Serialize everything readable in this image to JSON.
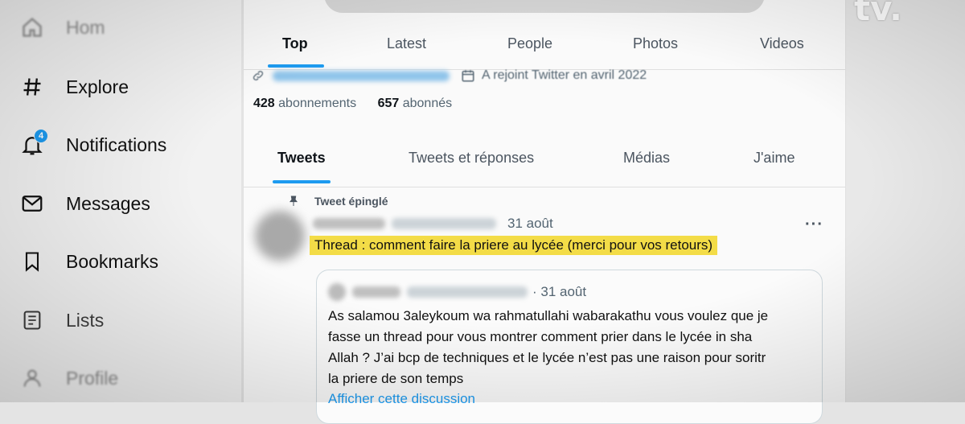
{
  "sidebar": {
    "items": [
      {
        "label": "Hom",
        "icon": "home-icon"
      },
      {
        "label": "Explore",
        "icon": "hashtag-icon"
      },
      {
        "label": "Notifications",
        "icon": "bell-icon",
        "badge": "4"
      },
      {
        "label": "Messages",
        "icon": "envelope-icon"
      },
      {
        "label": "Bookmarks",
        "icon": "bookmark-icon"
      },
      {
        "label": "Lists",
        "icon": "list-icon"
      },
      {
        "label": "Profile",
        "icon": "profile-icon"
      }
    ]
  },
  "search_tabs": [
    {
      "label": "Top",
      "active": true
    },
    {
      "label": "Latest"
    },
    {
      "label": "People"
    },
    {
      "label": "Photos"
    },
    {
      "label": "Videos"
    }
  ],
  "profile": {
    "joined": "A rejoint Twitter en avril 2022",
    "following_count": "428",
    "following_label": "abonnements",
    "followers_count": "657",
    "followers_label": "abonnés"
  },
  "profile_tabs": [
    {
      "label": "Tweets",
      "active": true
    },
    {
      "label": "Tweets et réponses"
    },
    {
      "label": "Médias"
    },
    {
      "label": "J'aime"
    }
  ],
  "tweet": {
    "pinned_label": "Tweet épinglé",
    "date": "31 août",
    "text": "Thread : comment faire la priere au lycée (merci pour vos retours)",
    "more": "···",
    "highlight_color": "#f3dc47"
  },
  "quote": {
    "date": "· 31 août",
    "lines": [
      "As salamou 3aleykoum wa rahmatullahi wabarakathu vous voulez que je",
      "fasse un thread pour vous montrer comment prier dans le lycée in sha",
      "Allah ? J’ai bcp de techniques et le lycée n’est pas une raison pour soritr",
      "la priere de son temps"
    ],
    "show_thread": "Afficher cette discussion"
  },
  "logo": "tv.",
  "colors": {
    "accent": "#1d9bf0"
  }
}
